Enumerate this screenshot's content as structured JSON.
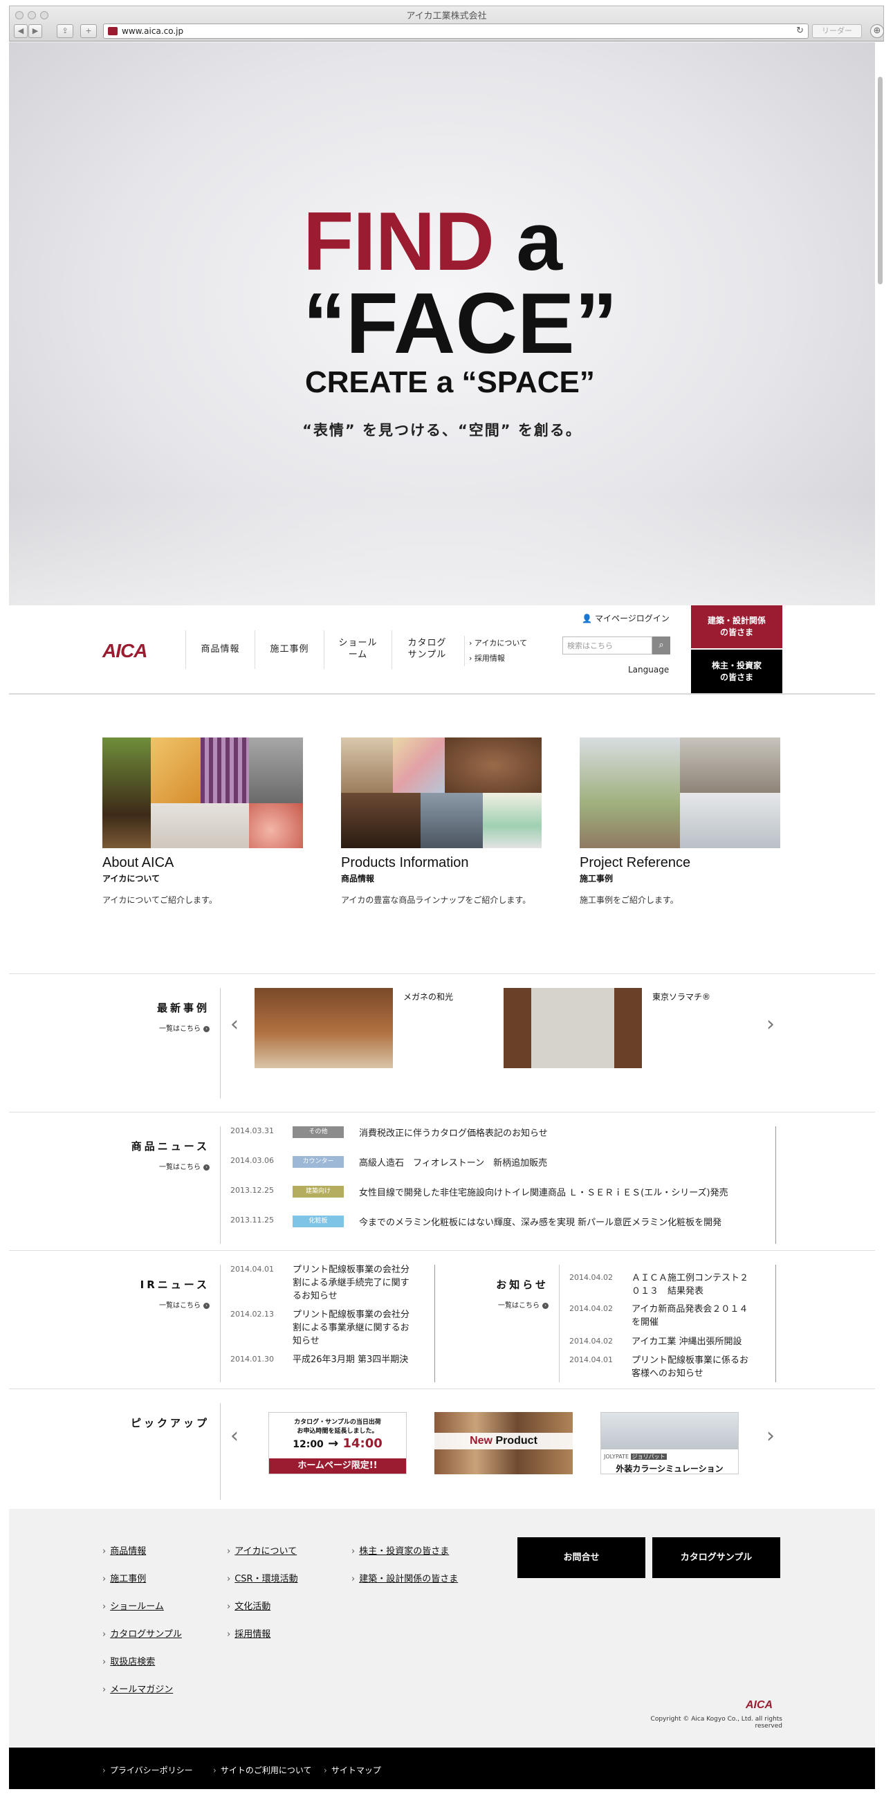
{
  "window": {
    "title": "アイカ工業株式会社",
    "url": "www.aica.co.jp",
    "reader_label": "リーダー"
  },
  "hero": {
    "line1_red": "FIND",
    "line1_black": " a",
    "line2": "“FACE”",
    "line3": "CREATE a “SPACE”",
    "tagline": "“表情” を見つける、“空間” を創る。"
  },
  "header": {
    "logo": "AICA",
    "nav": [
      {
        "label": "商品情報"
      },
      {
        "label": "施工事例"
      },
      {
        "label": "ショールーム"
      },
      {
        "label": "カタログ\nサンプル"
      }
    ],
    "sub_links": [
      "アイカについて",
      "採用情報"
    ],
    "mypage": "マイページログイン",
    "search_placeholder": "検索はこちら",
    "language": "Language",
    "btn_arch": "建築・設計関係\nの皆さま",
    "btn_ir": "株主・投資家\nの皆さま"
  },
  "cards": [
    {
      "title": "About AICA",
      "sub": "アイカについて",
      "desc": "アイカについてご紹介します。"
    },
    {
      "title": "Products Information",
      "sub": "商品情報",
      "desc": "アイカの豊富な商品ラインナップをご紹介します。"
    },
    {
      "title": "Project Reference",
      "sub": "施工事例",
      "desc": "施工事例をご紹介します。"
    }
  ],
  "cases": {
    "title": "最新事例",
    "more": "一覧はこちら",
    "items": [
      {
        "label": "メガネの和光"
      },
      {
        "label": "東京ソラマチ®"
      }
    ]
  },
  "product_news": {
    "title": "商品ニュース",
    "more": "一覧はこちら",
    "items": [
      {
        "date": "2014.03.31",
        "tag": "その他",
        "tag_color": "#8c8c8c",
        "text": "消費税改正に伴うカタログ価格表記のお知らせ"
      },
      {
        "date": "2014.03.06",
        "tag": "カウンター",
        "tag_color": "#9cb8d6",
        "text": "高級人造石　フィオレストーン　新柄追加販売"
      },
      {
        "date": "2013.12.25",
        "tag": "建築向け",
        "tag_color": "#b5ad5e",
        "text": "女性目線で開発した非住宅施設向けトイレ関連商品 Ｌ・ＳＥＲｉＥＳ(エル・シリーズ)発売"
      },
      {
        "date": "2013.11.25",
        "tag": "化粧板",
        "tag_color": "#7ec4e6",
        "text": "今までのメラミン化粧板にはない輝度、深み感を実現 新パール意匠メラミン化粧板を開発"
      }
    ]
  },
  "ir_news": {
    "title": "IRニュース",
    "more": "一覧はこちら",
    "items": [
      {
        "date": "2014.04.01",
        "text": "プリント配線板事業の会社分割による承継手続完了に関するお知らせ"
      },
      {
        "date": "2014.02.13",
        "text": "プリント配線板事業の会社分割による事業承継に関するお知らせ"
      },
      {
        "date": "2014.01.30",
        "text": "平成26年3月期 第3四半期決"
      }
    ]
  },
  "notices": {
    "title": "お知らせ",
    "more": "一覧はこちら",
    "items": [
      {
        "date": "2014.04.02",
        "text": "ＡＩＣＡ施工例コンテスト２０１３　結果発表"
      },
      {
        "date": "2014.04.02",
        "text": "アイカ新商品発表会２０１４を開催"
      },
      {
        "date": "2014.04.02",
        "text": "アイカ工業 沖縄出張所開設"
      },
      {
        "date": "2014.04.01",
        "text": "プリント配線板事業に係るお客様へのお知らせ"
      }
    ]
  },
  "pickup": {
    "title": "ピックアップ",
    "banner1": {
      "line1": "カタログ・サンプルの当日出荷",
      "line2": "お申込時間を延長しました。",
      "from": "12:00",
      "to": "14:00",
      "foot": "ホームページ限定!!"
    },
    "banner2": {
      "new": "New",
      "product": " Product"
    },
    "banner3": {
      "brand": "JOLYPATE",
      "badge": "ジョリパット",
      "text": "外装カラーシミュレーション"
    }
  },
  "footer": {
    "col1": [
      "商品情報",
      "施工事例",
      "ショールーム",
      "カタログサンプル",
      "取扱店検索",
      "メールマガジン"
    ],
    "col2": [
      "アイカについて",
      "CSR・環境活動",
      "文化活動",
      "採用情報"
    ],
    "col3": [
      "株主・投資家の皆さま",
      "建築・設計関係の皆さま"
    ],
    "btn_contact": "お問合せ",
    "btn_catalog": "カタログサンプル",
    "logo": "AICA",
    "copyright": "Copyright © Aica Kogyo Co., Ltd. all rights reserved"
  },
  "bottom_links": [
    "プライバシーポリシー",
    "サイトのご利用について",
    "サイトマップ"
  ],
  "colors": {
    "brand": "#9b1b30",
    "black": "#000000",
    "footer_bg": "#f1f1f1"
  }
}
